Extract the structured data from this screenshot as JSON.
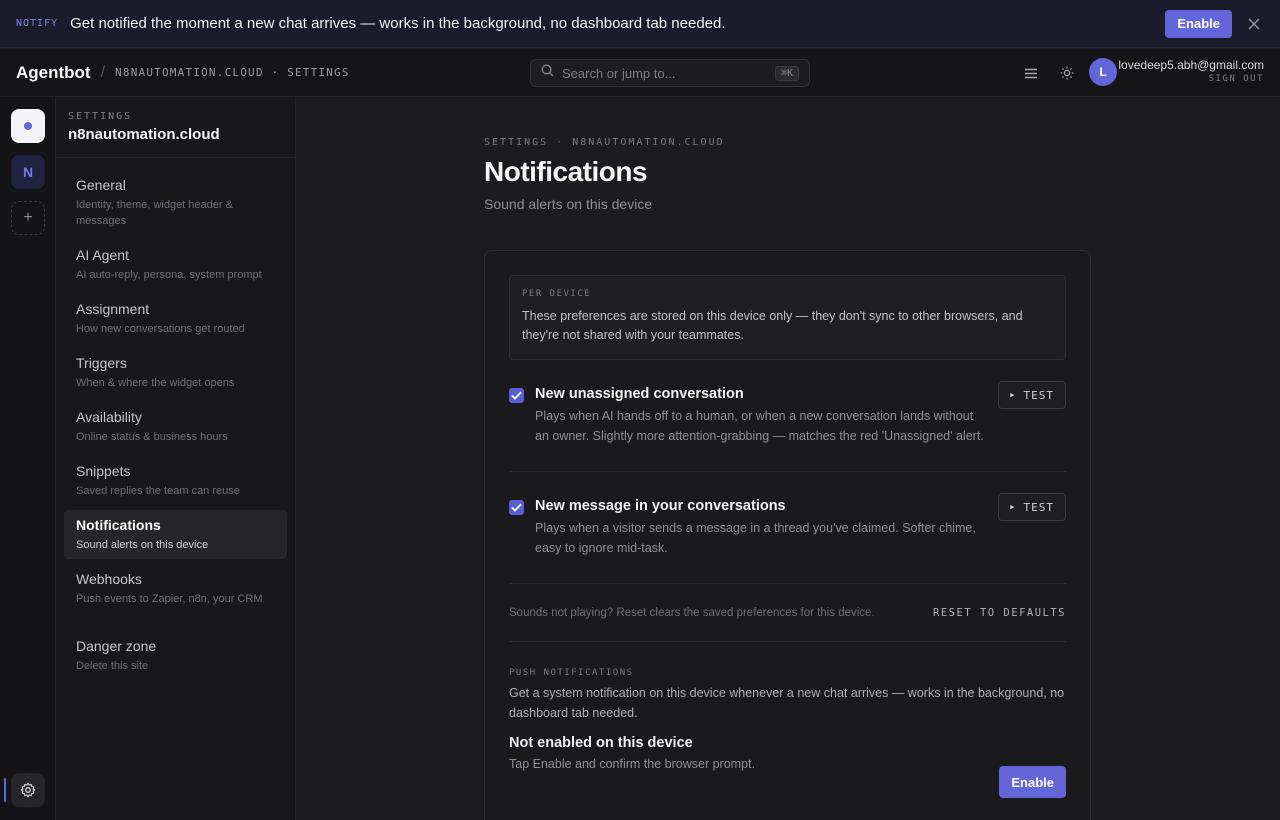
{
  "banner": {
    "tag": "NOTIFY",
    "message": "Get notified the moment a new chat arrives — works in the background, no dashboard tab needed.",
    "enable_label": "Enable",
    "close_icon": "close-icon"
  },
  "topnav": {
    "brand": "Agentbot",
    "separator": "/",
    "crumb": "N8NAUTOMATION.CLOUD · SETTINGS",
    "search_placeholder": "Search or jump to...",
    "search_shortcut": "⌘K",
    "icons": [
      "menu-icon",
      "sun-icon"
    ],
    "avatar_initial": "L",
    "user_email": "lovedeep5.abh@gmail.com",
    "sign_out": "SIGN OUT"
  },
  "rail": {
    "site_initial": "N",
    "add_label": "+",
    "icons": [
      "workspace-dot-icon",
      "site-n-icon",
      "add-site-icon",
      "gear-icon"
    ]
  },
  "sidebar": {
    "eyebrow": "SETTINGS",
    "site": "n8nautomation.cloud",
    "items": [
      {
        "label": "General",
        "desc": "Identity, theme, widget header & messages"
      },
      {
        "label": "AI Agent",
        "desc": "AI auto-reply, persona, system prompt"
      },
      {
        "label": "Assignment",
        "desc": "How new conversations get routed"
      },
      {
        "label": "Triggers",
        "desc": "When & where the widget opens"
      },
      {
        "label": "Availability",
        "desc": "Online status & business hours"
      },
      {
        "label": "Snippets",
        "desc": "Saved replies the team can reuse"
      },
      {
        "label": "Notifications",
        "desc": "Sound alerts on this device"
      },
      {
        "label": "Webhooks",
        "desc": "Push events to Zapier, n8n, your CRM"
      },
      {
        "label": "Danger zone",
        "desc": "Delete this site"
      }
    ],
    "active": "Notifications"
  },
  "page": {
    "eyebrow": "SETTINGS · N8NAUTOMATION.CLOUD",
    "title": "Notifications",
    "subtitle": "Sound alerts on this device"
  },
  "card": {
    "info_label": "PER DEVICE",
    "info_text": "These preferences are stored on this device only — they don't sync to other browsers, and they're not shared with your teammates.",
    "rows": [
      {
        "checked": true,
        "title": "New unassigned conversation",
        "desc": "Plays when AI hands off to a human, or when a new conversation lands without an owner. Slightly more attention-grabbing — matches the red 'Unassigned' alert.",
        "test_label": "TEST"
      },
      {
        "checked": true,
        "title": "New message in your conversations",
        "desc": "Plays when a visitor sends a message in a thread you've claimed. Softer chime, easy to ignore mid-task.",
        "test_label": "TEST"
      }
    ],
    "reset_note": "Sounds not playing? Reset clears the saved preferences for this device.",
    "reset_label": "RESET TO DEFAULTS",
    "push_label": "PUSH NOTIFICATIONS",
    "push_text": "Get a system notification on this device whenever a new chat arrives — works in the background, no dashboard tab needed.",
    "push_state": "Not enabled on this device",
    "push_hint": "Tap Enable and confirm the browser prompt.",
    "push_enable": "Enable"
  },
  "colors": {
    "accent": "#6366d9",
    "background": "#1c1c1e",
    "banner_bg": "#1a1c2b"
  }
}
